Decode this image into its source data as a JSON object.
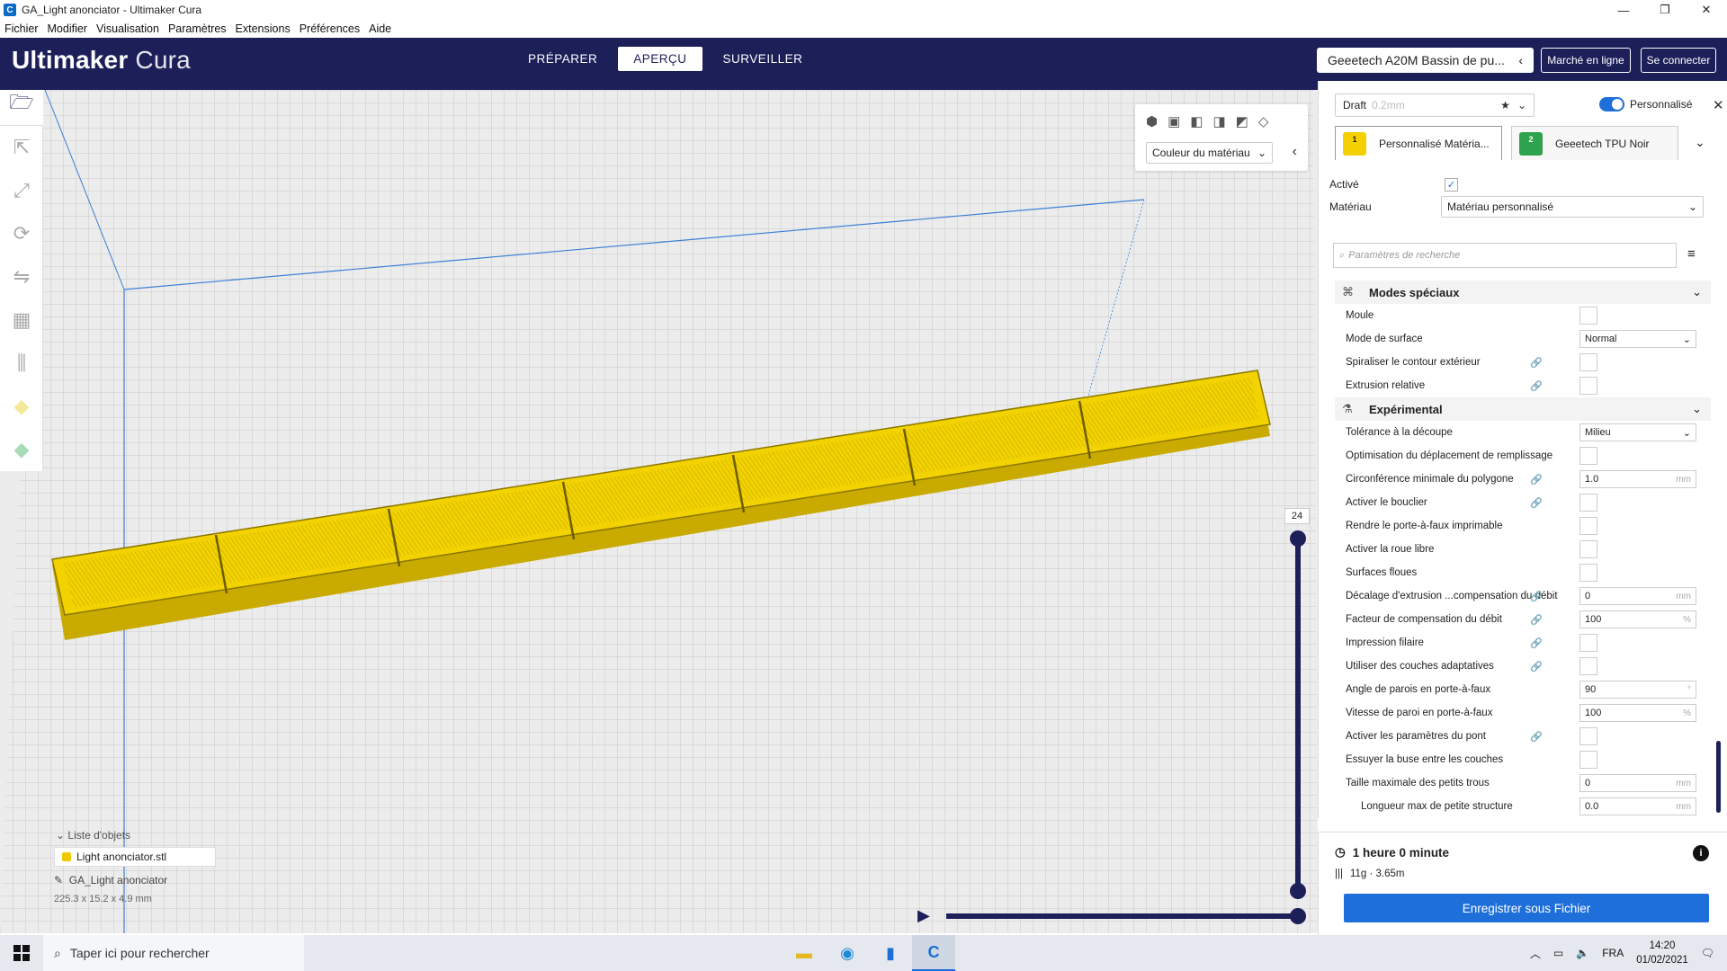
{
  "window": {
    "title": "GA_Light anonciator - Ultimaker Cura",
    "app_icon": "C",
    "minimize": "—",
    "maximize": "❐",
    "close": "✕"
  },
  "menu": [
    "Fichier",
    "Modifier",
    "Visualisation",
    "Paramètres",
    "Extensions",
    "Préférences",
    "Aide"
  ],
  "header": {
    "logo_bold": "Ultimaker",
    "logo_light": "Cura",
    "stages": [
      "PRÉPARER",
      "APERÇU",
      "SURVEILLER"
    ],
    "active_stage": "APERÇU",
    "printer": "Geeetech A20M Bassin de pu...",
    "marketplace": "Marché en ligne",
    "signin": "Se connecter"
  },
  "viewport": {
    "color_scheme": "Couleur du matériau",
    "layer_number": "24",
    "object_list_title": "Liste d'objets",
    "object_file": "Light anonciator.stl",
    "project_name": "GA_Light anonciator",
    "dimensions": "225.3 x 15.2 x 4.9 mm",
    "model_color": "#f2d200"
  },
  "settings_panel": {
    "profile": "Draft",
    "profile_sub": "0.2mm",
    "custom_label": "Personnalisé",
    "extruder1": {
      "num": "1",
      "label": "Personnalisé Matéria...",
      "color": "#f5d000"
    },
    "extruder2": {
      "num": "2",
      "label": "Geeetech TPU Noir",
      "color": "#2ea24c"
    },
    "enabled_label": "Activé",
    "material_label": "Matériau",
    "material_value": "Matériau personnalisé",
    "search_placeholder": "Paramètres de recherche",
    "cat_special": "Modes spéciaux",
    "cat_experimental": "Expérimental",
    "special": [
      {
        "label": "Moule",
        "type": "box"
      },
      {
        "label": "Mode de surface",
        "type": "dd",
        "value": "Normal"
      },
      {
        "label": "Spiraliser le contour extérieur",
        "type": "box",
        "link": true
      },
      {
        "label": "Extrusion relative",
        "type": "box",
        "link": true
      }
    ],
    "experimental": [
      {
        "label": "Tolérance à la découpe",
        "type": "dd",
        "value": "Milieu"
      },
      {
        "label": "Optimisation du déplacement de remplissage",
        "type": "box"
      },
      {
        "label": "Circonférence minimale du polygone",
        "type": "val",
        "value": "1.0",
        "unit": "mm",
        "link": true
      },
      {
        "label": "Activer le bouclier",
        "type": "box",
        "link": true
      },
      {
        "label": "Rendre le porte-à-faux imprimable",
        "type": "box"
      },
      {
        "label": "Activer la roue libre",
        "type": "box"
      },
      {
        "label": "Surfaces floues",
        "type": "box"
      },
      {
        "label": "Décalage d'extrusion ...compensation du débit",
        "type": "val",
        "value": "0",
        "unit": "mm",
        "link": true
      },
      {
        "label": "Facteur de compensation du débit",
        "type": "val",
        "value": "100",
        "unit": "%",
        "link": true
      },
      {
        "label": "Impression filaire",
        "type": "box",
        "link": true
      },
      {
        "label": "Utiliser des couches adaptatives",
        "type": "box",
        "link": true
      },
      {
        "label": "Angle de parois en porte-à-faux",
        "type": "val",
        "value": "90",
        "unit": "°"
      },
      {
        "label": "Vitesse de paroi en porte-à-faux",
        "type": "val",
        "value": "100",
        "unit": "%"
      },
      {
        "label": "Activer les paramètres du pont",
        "type": "box",
        "link": true
      },
      {
        "label": "Essuyer la buse entre les couches",
        "type": "box"
      },
      {
        "label": "Taille maximale des petits trous",
        "type": "val",
        "value": "0",
        "unit": "mm"
      },
      {
        "label": "Longueur max de petite structure",
        "type": "val",
        "value": "0.0",
        "unit": "mm",
        "indent": true
      }
    ]
  },
  "print_info": {
    "time": "1 heure 0 minute",
    "material": "11g · 3.65m",
    "save": "Enregistrer sous Fichier"
  },
  "taskbar": {
    "search_placeholder": "Taper ici pour rechercher",
    "lang": "FRA",
    "time": "14:20",
    "date": "01/02/2021"
  }
}
